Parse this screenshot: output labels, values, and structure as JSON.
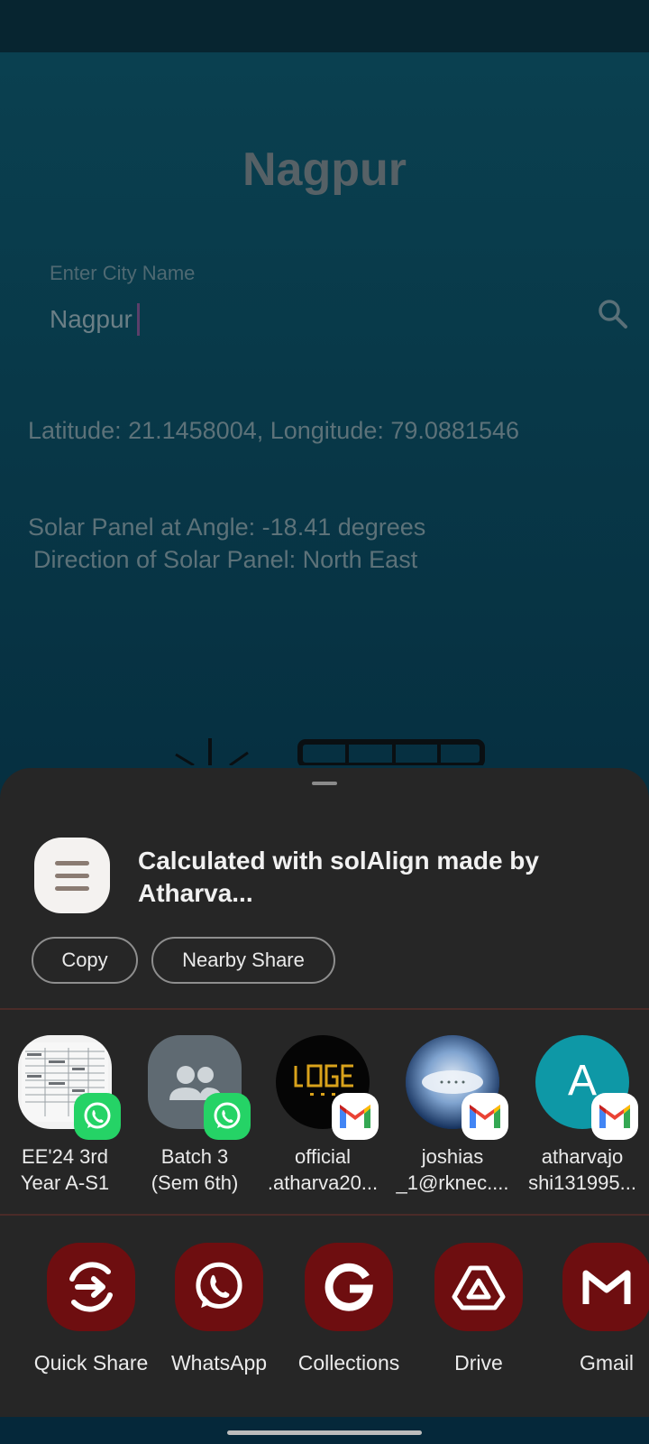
{
  "app": {
    "title": "Nagpur",
    "input_label": "Enter City Name",
    "input_value": "Nagpur",
    "coords_text": "Latitude: 21.1458004, Longitude: 79.0881546",
    "angle_text": "Solar Panel at Angle: -18.41 degrees",
    "direction_text": "Direction of Solar Panel: North East"
  },
  "share_sheet": {
    "preview_text": "Calculated with solAlign made by Atharva...",
    "chips": {
      "copy": "Copy",
      "nearby": "Nearby Share"
    },
    "contacts": [
      {
        "line1": "EE'24 3rd",
        "line2": "Year A-S1",
        "badge": "whatsapp"
      },
      {
        "line1": "Batch 3",
        "line2": "(Sem 6th)",
        "badge": "whatsapp"
      },
      {
        "line1": "official",
        "line2": ".atharva20...",
        "badge": "gmail"
      },
      {
        "line1": "joshias",
        "line2": "_1@rknec....",
        "badge": "gmail"
      },
      {
        "line1": "atharvajo",
        "line2": "shi131995...",
        "badge": "gmail",
        "avatar_letter": "A"
      }
    ],
    "apps": [
      {
        "label": "Quick Share",
        "icon": "quick-share-icon"
      },
      {
        "label": "WhatsApp",
        "icon": "whatsapp-icon"
      },
      {
        "label": "Collections",
        "icon": "google-icon"
      },
      {
        "label": "Drive",
        "icon": "drive-icon"
      },
      {
        "label": "Gmail",
        "icon": "gmail-icon"
      }
    ]
  },
  "colors": {
    "sheet_bg": "#262626",
    "app_tile": "#6e0e10",
    "whatsapp": "#25d366",
    "accent_teal": "#0e98a6"
  }
}
